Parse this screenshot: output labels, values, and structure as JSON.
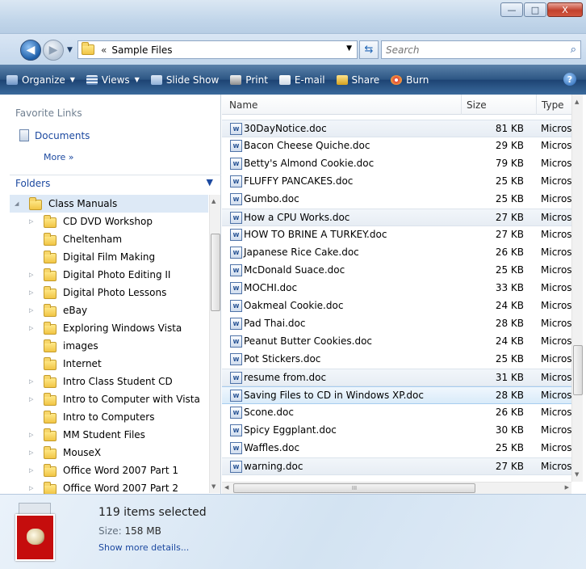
{
  "window": {
    "controls": {
      "minimize": "—",
      "maximize": "□",
      "close": "X"
    }
  },
  "address": {
    "breadcrumb_chevron": "«",
    "path": "Sample Files",
    "search_placeholder": "Search"
  },
  "toolbar": {
    "organize": "Organize",
    "views": "Views",
    "slideshow": "Slide Show",
    "print": "Print",
    "email": "E-mail",
    "share": "Share",
    "burn": "Burn",
    "help": "?"
  },
  "nav": {
    "favorites_heading": "Favorite Links",
    "documents": "Documents",
    "more": "More  »",
    "folders_heading": "Folders",
    "tree": [
      {
        "label": "Class Manuals",
        "expander": "open",
        "level": 0,
        "selected": true
      },
      {
        "label": "CD DVD Workshop",
        "expander": "closed",
        "level": 1
      },
      {
        "label": "Cheltenham",
        "expander": "none",
        "level": 1
      },
      {
        "label": "Digital Film Making",
        "expander": "none",
        "level": 1
      },
      {
        "label": "Digital Photo Editing II",
        "expander": "closed",
        "level": 1
      },
      {
        "label": "Digital Photo Lessons",
        "expander": "closed",
        "level": 1
      },
      {
        "label": "eBay",
        "expander": "closed",
        "level": 1
      },
      {
        "label": "Exploring Windows Vista",
        "expander": "closed",
        "level": 1
      },
      {
        "label": "images",
        "expander": "none",
        "level": 1
      },
      {
        "label": "Internet",
        "expander": "none",
        "level": 1
      },
      {
        "label": "Intro Class Student CD",
        "expander": "closed",
        "level": 1
      },
      {
        "label": "Intro to Computer with Vista",
        "expander": "closed",
        "level": 1
      },
      {
        "label": "Intro to Computers",
        "expander": "none",
        "level": 1
      },
      {
        "label": "MM Student Files",
        "expander": "closed",
        "level": 1
      },
      {
        "label": "MouseX",
        "expander": "closed",
        "level": 1
      },
      {
        "label": "Office Word 2007 Part 1",
        "expander": "closed",
        "level": 1
      },
      {
        "label": "Office Word 2007 Part 2",
        "expander": "closed",
        "level": 1
      }
    ]
  },
  "files": {
    "columns": {
      "name": "Name",
      "size": "Size",
      "type": "Type"
    },
    "rows": [
      {
        "name": "30DayNotice.doc",
        "size": "81 KB",
        "type": "Micros",
        "state": "hl"
      },
      {
        "name": "Bacon Cheese Quiche.doc",
        "size": "29 KB",
        "type": "Micros"
      },
      {
        "name": "Betty's Almond Cookie.doc",
        "size": "79 KB",
        "type": "Micros"
      },
      {
        "name": "FLUFFY PANCAKES.doc",
        "size": "25 KB",
        "type": "Micros"
      },
      {
        "name": "Gumbo.doc",
        "size": "25 KB",
        "type": "Micros"
      },
      {
        "name": "How a CPU Works.doc",
        "size": "27 KB",
        "type": "Micros",
        "state": "hl"
      },
      {
        "name": "HOW TO BRINE A TURKEY.doc",
        "size": "27 KB",
        "type": "Micros"
      },
      {
        "name": "Japanese Rice Cake.doc",
        "size": "26 KB",
        "type": "Micros"
      },
      {
        "name": "McDonald Suace.doc",
        "size": "25 KB",
        "type": "Micros"
      },
      {
        "name": "MOCHI.doc",
        "size": "33 KB",
        "type": "Micros"
      },
      {
        "name": "Oakmeal Cookie.doc",
        "size": "24 KB",
        "type": "Micros"
      },
      {
        "name": "Pad Thai.doc",
        "size": "28 KB",
        "type": "Micros"
      },
      {
        "name": "Peanut Butter Cookies.doc",
        "size": "24 KB",
        "type": "Micros"
      },
      {
        "name": "Pot Stickers.doc",
        "size": "25 KB",
        "type": "Micros"
      },
      {
        "name": "resume from.doc",
        "size": "31 KB",
        "type": "Micros",
        "state": "hl"
      },
      {
        "name": "Saving Files to CD in Windows XP.doc",
        "size": "28 KB",
        "type": "Micros",
        "state": "sel"
      },
      {
        "name": "Scone.doc",
        "size": "26 KB",
        "type": "Micros"
      },
      {
        "name": "Spicy Eggplant.doc",
        "size": "30 KB",
        "type": "Micros"
      },
      {
        "name": "Waffles.doc",
        "size": "25 KB",
        "type": "Micros"
      },
      {
        "name": "warning.doc",
        "size": "27 KB",
        "type": "Micros",
        "state": "hl"
      }
    ],
    "hscroll_grip": "III"
  },
  "details": {
    "count": "119 items selected",
    "size_label": "Size:",
    "size_value": "158 MB",
    "more_link": "Show more details..."
  },
  "colors": {
    "accent": "#1c49a0",
    "command_bar": "#2c5684",
    "folder": "#f1c545"
  }
}
